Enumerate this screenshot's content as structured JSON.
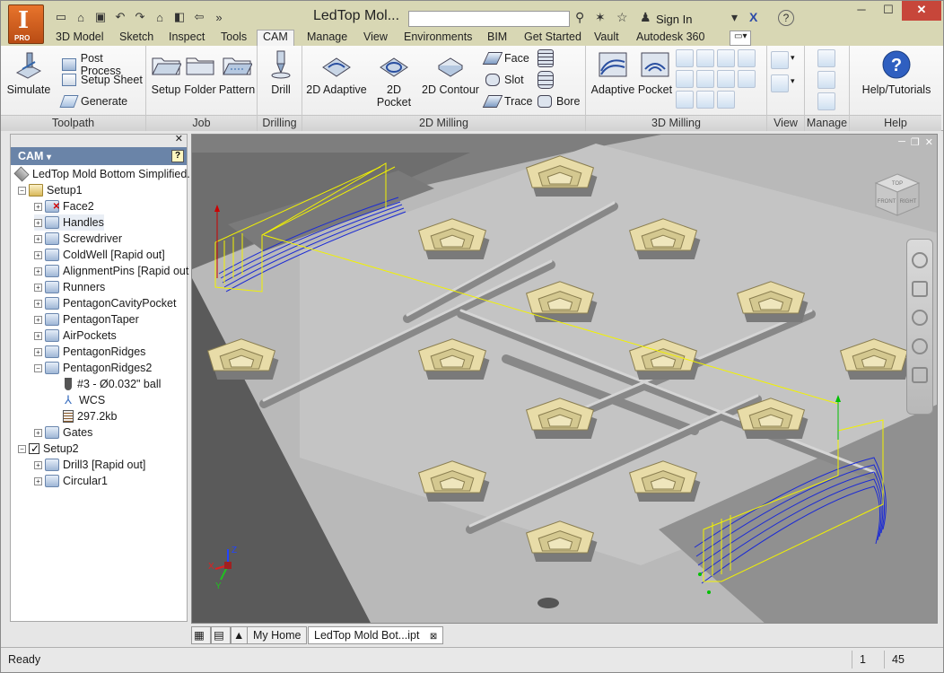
{
  "window": {
    "title": "LedTop Mol...",
    "logo_letter": "I",
    "logo_badge": "PRO",
    "search_placeholder": "",
    "sign_in": "Sign In",
    "help": "?"
  },
  "ribbon_tabs": [
    "3D Model",
    "Sketch",
    "Inspect",
    "Tools",
    "CAM",
    "Manage",
    "View",
    "Environments",
    "BIM",
    "Get Started",
    "Vault",
    "Autodesk 360"
  ],
  "active_tab": "CAM",
  "ribbon": {
    "toolpath": {
      "title": "Toolpath",
      "simulate": "Simulate",
      "post_process": "Post Process",
      "setup_sheet": "Setup Sheet",
      "generate": "Generate"
    },
    "job": {
      "title": "Job",
      "setup": "Setup",
      "folder": "Folder",
      "pattern": "Pattern"
    },
    "drilling": {
      "title": "Drilling",
      "drill": "Drill"
    },
    "milling2d": {
      "title": "2D Milling",
      "adaptive": "2D Adaptive",
      "pocket": "2D Pocket",
      "contour": "2D Contour",
      "face": "Face",
      "slot": "Slot",
      "trace": "Trace",
      "bore": "Bore"
    },
    "milling3d": {
      "title": "3D Milling",
      "adaptive": "Adaptive",
      "pocket": "Pocket"
    },
    "view": {
      "title": "View"
    },
    "manage": {
      "title": "Manage"
    },
    "help": {
      "title": "Help",
      "tutorials": "Help/Tutorials"
    }
  },
  "browser": {
    "header": "CAM",
    "root": "LedTop Mold Bottom Simplified.",
    "items": [
      {
        "label": "Setup1",
        "level": 1,
        "icon": "setup",
        "expander": "−"
      },
      {
        "label": "Face2",
        "level": 2,
        "icon": "op-red",
        "expander": "+"
      },
      {
        "label": "Handles",
        "level": 2,
        "icon": "op",
        "expander": "+"
      },
      {
        "label": "Screwdriver",
        "level": 2,
        "icon": "op",
        "expander": "+"
      },
      {
        "label": "ColdWell [Rapid out]",
        "level": 2,
        "icon": "op",
        "expander": "+"
      },
      {
        "label": "AlignmentPins [Rapid out",
        "level": 2,
        "icon": "op",
        "expander": "+"
      },
      {
        "label": "Runners",
        "level": 2,
        "icon": "op",
        "expander": "+"
      },
      {
        "label": "PentagonCavityPocket",
        "level": 2,
        "icon": "op",
        "expander": "+"
      },
      {
        "label": "PentagonTaper",
        "level": 2,
        "icon": "op",
        "expander": "+"
      },
      {
        "label": "AirPockets",
        "level": 2,
        "icon": "op",
        "expander": "+"
      },
      {
        "label": "PentagonRidges",
        "level": 2,
        "icon": "op",
        "expander": "+"
      },
      {
        "label": "PentagonRidges2",
        "level": 2,
        "icon": "op",
        "expander": "−"
      },
      {
        "label": "#3 - Ø0.032\" ball",
        "level": 3,
        "icon": "tool",
        "expander": ""
      },
      {
        "label": "WCS",
        "level": 3,
        "icon": "wcs",
        "expander": ""
      },
      {
        "label": "297.2kb",
        "level": 3,
        "icon": "file",
        "expander": ""
      },
      {
        "label": "Gates",
        "level": 2,
        "icon": "op",
        "expander": "+"
      },
      {
        "label": "Setup2",
        "level": 1,
        "icon": "check",
        "expander": "−"
      },
      {
        "label": "Drill3 [Rapid out]",
        "level": 2,
        "icon": "op",
        "expander": "+"
      },
      {
        "label": "Circular1",
        "level": 2,
        "icon": "op",
        "expander": "+"
      }
    ]
  },
  "viewcube": {
    "top": "TOP",
    "front": "FRONT",
    "right": "RIGHT"
  },
  "doc_tabs": {
    "home": "My Home",
    "document": "LedTop Mold Bot...ipt"
  },
  "status": {
    "text": "Ready",
    "cell1": "1",
    "cell2": "45"
  },
  "colors": {
    "toolpath_blue": "#1c2bd4",
    "toolpath_yellow": "#f2f200",
    "pentagon": "#e8dca8",
    "mold": "#b8b8b8"
  }
}
